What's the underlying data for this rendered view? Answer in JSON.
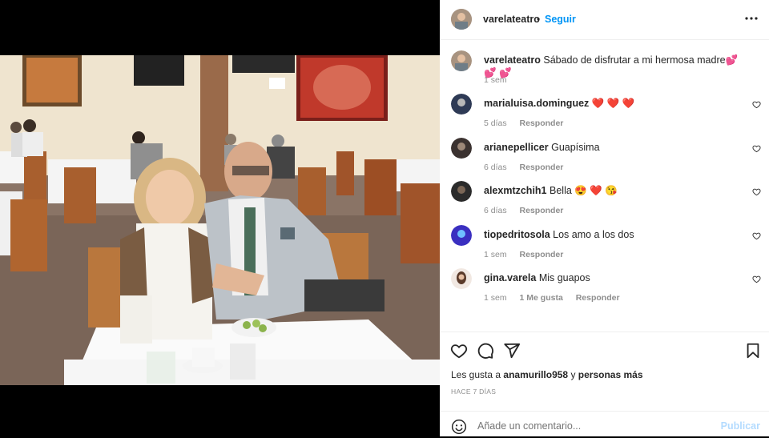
{
  "post": {
    "username": "varelateatro",
    "dot": "•",
    "follow_label": "Seguir",
    "caption_user": "varelateatro",
    "caption_text": "Sábado de disfrutar a mi hermosa madre💕 💕 💕",
    "caption_time": "1 sem"
  },
  "comments": [
    {
      "user": "marialuisa.dominguez",
      "text": "❤️ ❤️ ❤️",
      "time": "5 días",
      "likes": "",
      "reply": "Responder"
    },
    {
      "user": "arianepellicer",
      "text": "Guapísima",
      "time": "6 días",
      "likes": "",
      "reply": "Responder"
    },
    {
      "user": "alexmtzchih1",
      "text": "Bella 😍 ❤️ 😘",
      "time": "6 días",
      "likes": "",
      "reply": "Responder"
    },
    {
      "user": "tiopedritosola",
      "text": "Los amo a los dos",
      "time": "1 sem",
      "likes": "",
      "reply": "Responder"
    },
    {
      "user": "gina.varela",
      "text": "Mis guapos",
      "time": "1 sem",
      "likes": "1 Me gusta",
      "reply": "Responder"
    }
  ],
  "likes": {
    "prefix": "Les gusta a",
    "user": "anamurillo958",
    "middle": "y",
    "suffix": "personas más"
  },
  "timestamp": "HACE 7 DÍAS",
  "add_comment": {
    "placeholder": "Añade un comentario...",
    "post_label": "Publicar"
  },
  "icons": {
    "like": "heart-icon",
    "comment": "comment-icon",
    "share": "paper-plane-icon",
    "save": "bookmark-icon",
    "more": "more-horizontal-icon",
    "emoji": "emoji-icon"
  },
  "colors": {
    "follow": "#0095f6",
    "publish_disabled": "#b3dbff",
    "muted": "#8e8e8e",
    "text": "#262626"
  }
}
